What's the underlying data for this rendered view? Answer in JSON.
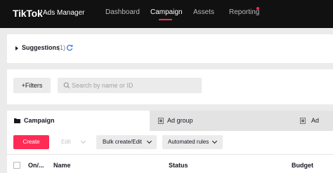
{
  "brand": {
    "logo": "TikTok",
    "subtitle": "Ads Manager"
  },
  "nav": {
    "items": [
      {
        "label": "Dashboard"
      },
      {
        "label": "Campaign"
      },
      {
        "label": "Assets"
      },
      {
        "label": "Reporting"
      }
    ],
    "active": "Campaign",
    "accent_color": "#fe2c55"
  },
  "suggestions": {
    "label": "Suggestions",
    "count": "(1)"
  },
  "filters": {
    "button_label": "+Filters",
    "search_placeholder": "Search by name or ID",
    "search_value": ""
  },
  "tabs": [
    {
      "label": "Campaign",
      "icon": "folder-icon"
    },
    {
      "label": "Ad group",
      "icon": "document-icon"
    },
    {
      "label": "Ad",
      "icon": "document-icon"
    }
  ],
  "toolbar": {
    "create": "Create",
    "edit": "Edit",
    "bulk": "Bulk create/Edit",
    "rules": "Automated rules"
  },
  "table": {
    "columns": [
      "On/...",
      "Name",
      "Status",
      "Budget"
    ]
  }
}
